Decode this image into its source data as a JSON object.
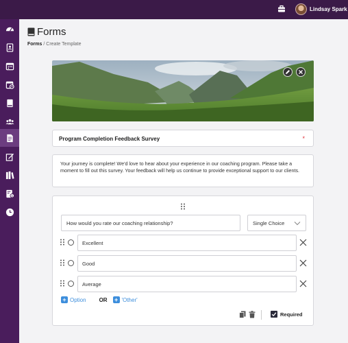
{
  "topbar": {
    "user_name": "Lindsay Spark"
  },
  "sidebar": {
    "items": [
      {
        "icon": "dashboard-icon"
      },
      {
        "icon": "contacts-icon"
      },
      {
        "icon": "calendar-icon"
      },
      {
        "icon": "schedule-icon"
      },
      {
        "icon": "book-icon"
      },
      {
        "icon": "clients-icon"
      },
      {
        "icon": "forms-icon",
        "active": true
      },
      {
        "icon": "notes-icon"
      },
      {
        "icon": "library-icon"
      },
      {
        "icon": "invoice-icon"
      },
      {
        "icon": "clock-icon"
      }
    ]
  },
  "page": {
    "title": "Forms",
    "breadcrumb": {
      "link": "Forms",
      "separator": "/",
      "current": "Create Template"
    }
  },
  "form": {
    "title": "Program Completion Feedback Survey",
    "required_mark": "*",
    "description": "Your journey is complete! We'd love to hear about your experience in our coaching program. Please take a moment to fill out this survey. Your feedback will help us continue to provide exceptional support to our clients.",
    "question": {
      "text": "How would you rate our coaching relationship?",
      "type": "Single Choice",
      "options": [
        "Excellent",
        "Good",
        "Average"
      ],
      "add_option_label": "Option",
      "or_label": "OR",
      "add_other_label": "'Other'",
      "required_label": "Required",
      "required_checked": true
    }
  },
  "colors": {
    "sidebar": "#4a1d5c",
    "topbar": "#3b1a48",
    "accent": "#3d8edc",
    "required": "#e0313b"
  }
}
